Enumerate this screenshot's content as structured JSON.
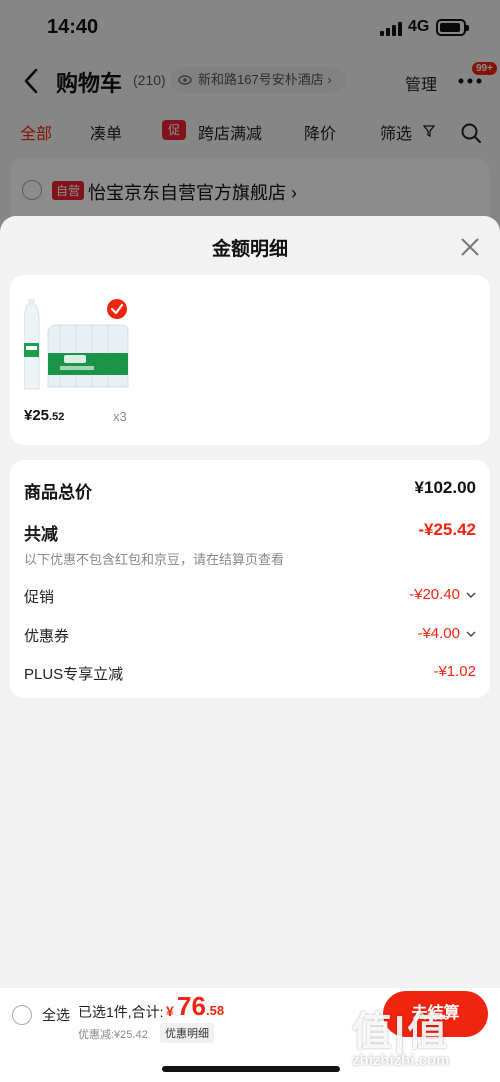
{
  "status_bar": {
    "time": "14:40",
    "network": "4G"
  },
  "nav": {
    "title": "购物车",
    "count": "(210)",
    "address": "新和路167号安朴酒店",
    "manage": "管理",
    "badge": "99+"
  },
  "filters": {
    "all": "全部",
    "bundle": "凑单",
    "promo_tag": "促",
    "cross_store": "跨店满减",
    "price_drop": "降价",
    "filter": "筛选"
  },
  "shop": {
    "tag": "自营",
    "name": "怡宝京东自营官方旗舰店"
  },
  "sheet": {
    "title": "金额明细",
    "product": {
      "price_int": "¥25",
      "price_dec": ".52",
      "quantity": "x3"
    },
    "details": {
      "total_label": "商品总价",
      "total_value": "¥102.00",
      "reduce_label": "共减",
      "reduce_value": "-¥25.42",
      "note": "以下优惠不包含红包和京豆，请在结算页查看",
      "promo_label": "促销",
      "promo_value": "-¥20.40",
      "coupon_label": "优惠券",
      "coupon_value": "-¥4.00",
      "plus_label": "PLUS专享立减",
      "plus_value": "-¥1.02"
    }
  },
  "bottom": {
    "select_all": "全选",
    "selected_text": "已选1件,合计:",
    "total_currency": "¥",
    "total_int": "76",
    "total_dec": ".58",
    "discount_text": "优惠减:¥25.42",
    "detail_button": "优惠明细",
    "checkout": "去结算"
  },
  "watermark": {
    "logo": "值|值",
    "url": "zhizhizhi.com"
  },
  "colors": {
    "accent": "#f0250f",
    "sheet_bg": "#f2f2f2"
  }
}
